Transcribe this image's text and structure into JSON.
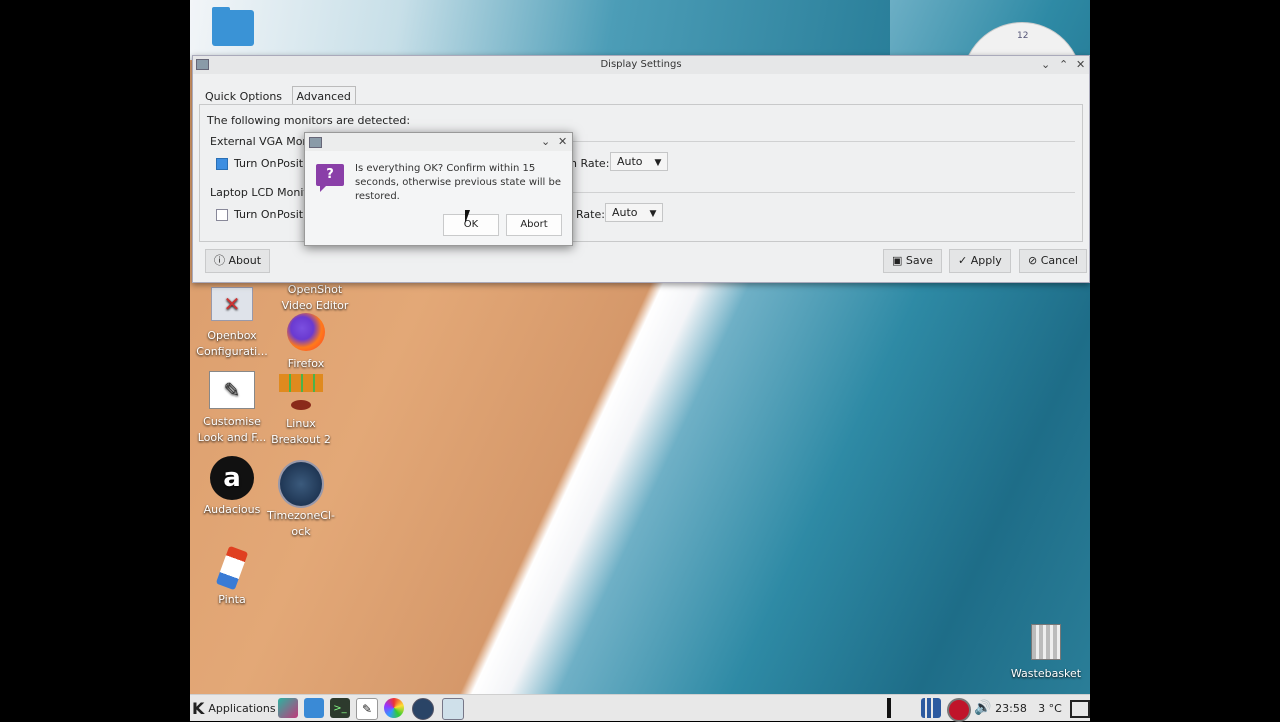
{
  "display_settings": {
    "title": "Display Settings",
    "tabs": [
      {
        "label": "Quick Options"
      },
      {
        "label": "Advanced"
      }
    ],
    "detected_text": "The following monitors are detected:",
    "monitors": [
      {
        "name": "External VGA Monito",
        "turn_on_label": "Turn On",
        "turn_on": true,
        "position_label": "Positi",
        "refresh_label": "h Rate:",
        "refresh_value": "Auto"
      },
      {
        "name": "Laptop LCD Monitor",
        "turn_on_label": "Turn On",
        "turn_on": false,
        "position_label": "Positi",
        "refresh_label": "Rate:",
        "refresh_value": "Auto"
      }
    ],
    "buttons": {
      "about": "About",
      "save": "Save",
      "apply": "Apply",
      "cancel": "Cancel"
    }
  },
  "dialog": {
    "message": "Is everything OK? Confirm within 15 seconds, otherwise previous state will be restored.",
    "ok_label": "OK",
    "abort_label": "Abort"
  },
  "desktop_icons": [
    {
      "label": "OpenShot\nVideo Editor"
    },
    {
      "label": "Openbox\nConfigurati..."
    },
    {
      "label": "Firefox"
    },
    {
      "label": "Customise\nLook and F..."
    },
    {
      "label": "Linux\nBreakout 2"
    },
    {
      "label": "Audacious"
    },
    {
      "label": "TimezoneCl-\nock"
    },
    {
      "label": "Pinta"
    },
    {
      "label": "Wastebasket"
    }
  ],
  "clock_widget": {
    "hour_mark": "12"
  },
  "taskbar": {
    "menu_label": "Applications",
    "time": "23:58",
    "weather": "3 °C"
  },
  "colors": {
    "accent": "#3d8ee1",
    "question_icon": "#8a3fa8"
  }
}
